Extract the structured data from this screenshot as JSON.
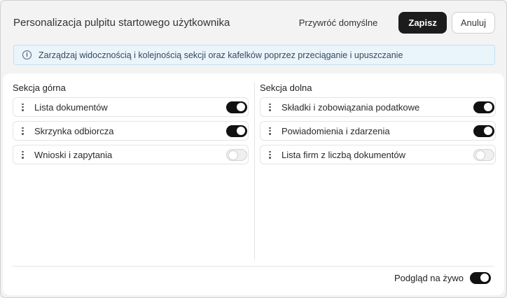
{
  "header": {
    "title": "Personalizacja pulpitu startowego użytkownika",
    "reset_label": "Przywróć domyślne",
    "save_label": "Zapisz",
    "cancel_label": "Anuluj"
  },
  "info": {
    "icon": "info-icon",
    "text": "Zarządzaj widocznością i kolejnością sekcji oraz kafelków poprzez przeciąganie i upuszczanie"
  },
  "sections": [
    {
      "title": "Sekcja górna",
      "items": [
        {
          "label": "Lista dokumentów",
          "enabled": true
        },
        {
          "label": "Skrzynka odbiorcza",
          "enabled": true
        },
        {
          "label": "Wnioski i zapytania",
          "enabled": false
        }
      ]
    },
    {
      "title": "Sekcja dolna",
      "items": [
        {
          "label": "Składki i zobowiązania podatkowe",
          "enabled": true
        },
        {
          "label": "Powiadomienia i zdarzenia",
          "enabled": true
        },
        {
          "label": "Lista firm z liczbą dokumentów",
          "enabled": false
        }
      ]
    }
  ],
  "footer": {
    "live_preview_label": "Podgląd na żywo",
    "live_preview_enabled": true
  }
}
